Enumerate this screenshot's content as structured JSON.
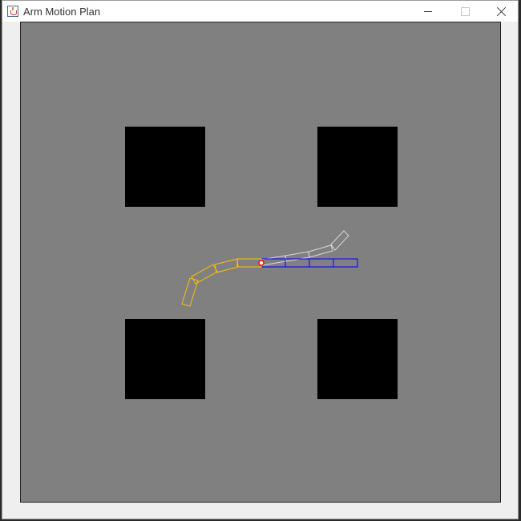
{
  "window": {
    "title": "Arm Motion Plan",
    "buttons": [
      "minimize",
      "maximize",
      "close"
    ]
  },
  "icons": {
    "app": "java-cup-icon",
    "minimize": "minimize-icon",
    "maximize": "maximize-icon",
    "close": "close-icon"
  },
  "scene": {
    "background_color": "#808080",
    "obstacle_color": "#000000",
    "obstacle_count": 4,
    "arms": [
      {
        "name": "start",
        "color": "#ffc000"
      },
      {
        "name": "goal",
        "color": "#0000ff"
      },
      {
        "name": "intermediate",
        "color": "#d8d8d8"
      }
    ],
    "base_marker_color": "#ff0000"
  }
}
